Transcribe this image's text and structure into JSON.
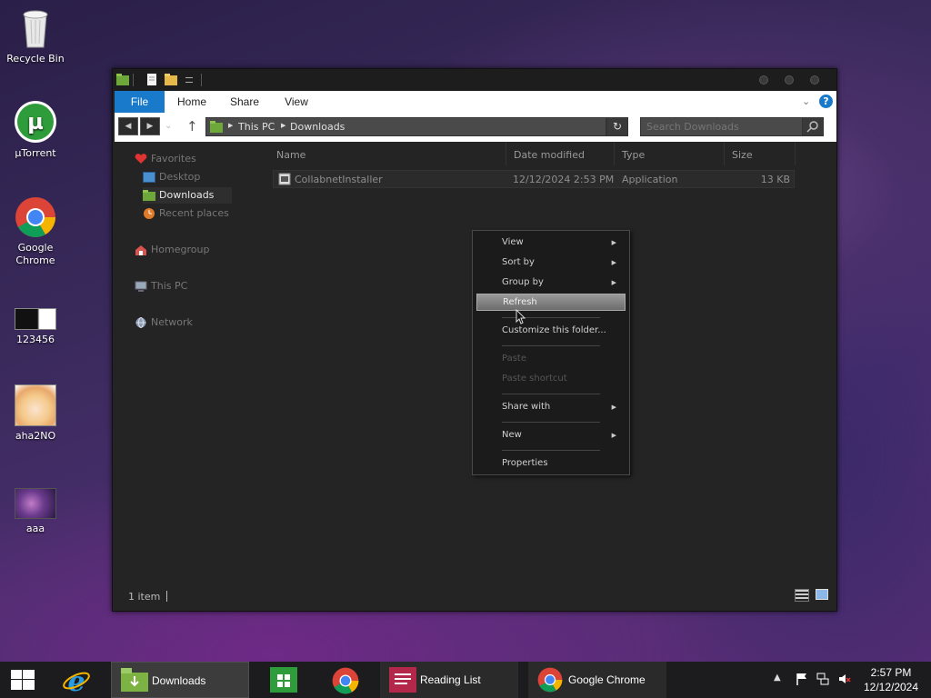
{
  "desktop": {
    "icons": [
      {
        "label": "Recycle Bin"
      },
      {
        "label": "µTorrent"
      },
      {
        "label": "Google Chrome"
      },
      {
        "label": "123456"
      },
      {
        "label": "aha2NO"
      },
      {
        "label": "aaa"
      }
    ]
  },
  "window": {
    "ribbon_tabs": [
      "File",
      "Home",
      "Share",
      "View"
    ],
    "breadcrumb": [
      "This PC",
      "Downloads"
    ],
    "search_placeholder": "Search Downloads",
    "nav_pane": {
      "favorites": "Favorites",
      "desktop": "Desktop",
      "downloads": "Downloads",
      "recent": "Recent places",
      "homegroup": "Homegroup",
      "this_pc": "This PC",
      "network": "Network"
    },
    "columns": [
      "Name",
      "Date modified",
      "Type",
      "Size"
    ],
    "files": [
      {
        "name": "CollabnetInstaller",
        "date": "12/12/2024 2:53 PM",
        "type": "Application",
        "size": "13 KB"
      }
    ],
    "status": "1 item"
  },
  "context_menu": {
    "items": [
      {
        "label": "View",
        "submenu": true
      },
      {
        "label": "Sort by",
        "submenu": true
      },
      {
        "label": "Group by",
        "submenu": true
      },
      {
        "label": "Refresh",
        "highlighted": true
      },
      {
        "label": "Customize this folder..."
      },
      {
        "label": "Paste",
        "disabled": true
      },
      {
        "label": "Paste shortcut",
        "disabled": true
      },
      {
        "label": "Share with",
        "submenu": true
      },
      {
        "label": "New",
        "submenu": true
      },
      {
        "label": "Properties"
      }
    ]
  },
  "taskbar": {
    "items": [
      {
        "label": "Downloads"
      },
      {
        "label": "Reading List"
      },
      {
        "label": "Google Chrome"
      }
    ],
    "clock": {
      "time": "2:57 PM",
      "date": "12/12/2024"
    }
  },
  "colors": {
    "accent": "#1979ca",
    "window_bg": "#242424",
    "taskbar_bg": "#1c1c1e"
  }
}
